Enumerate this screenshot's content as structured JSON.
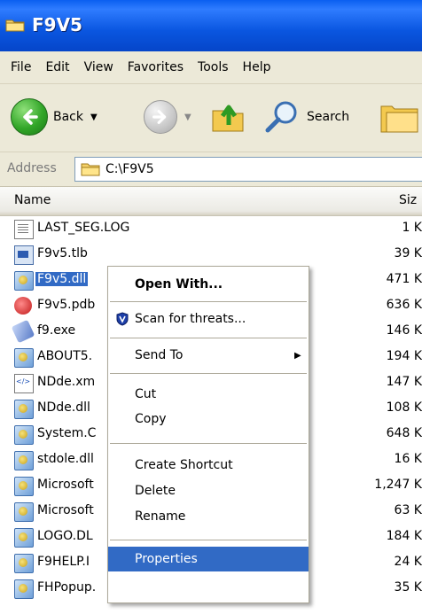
{
  "window": {
    "title": "F9V5"
  },
  "menu": [
    "File",
    "Edit",
    "View",
    "Favorites",
    "Tools",
    "Help"
  ],
  "toolbar": {
    "back_label": "Back",
    "search_label": "Search"
  },
  "address": {
    "label": "Address",
    "value": "C:\\F9V5"
  },
  "columns": {
    "name": "Name",
    "size": "Siz"
  },
  "files": [
    {
      "name": "LAST_SEG.LOG",
      "size": "1 K",
      "icon": "log-file-icon"
    },
    {
      "name": "F9v5.tlb",
      "size": "39 K",
      "icon": "type-library-icon"
    },
    {
      "name": "F9v5.dll",
      "size": "471 K",
      "icon": "dll-file-icon",
      "selected": true
    },
    {
      "name": "F9v5.pdb",
      "size": "636 K",
      "icon": "pdb-file-icon"
    },
    {
      "name": "f9.exe",
      "size": "146 K",
      "icon": "exe-file-icon"
    },
    {
      "name": "ABOUT5.",
      "size": "194 K",
      "icon": "dll-file-icon"
    },
    {
      "name": "NDde.xm",
      "size": "147 K",
      "icon": "xml-file-icon"
    },
    {
      "name": "NDde.dll",
      "size": "108 K",
      "icon": "dll-file-icon"
    },
    {
      "name": "System.C",
      "size": "648 K",
      "icon": "dll-file-icon"
    },
    {
      "name": "stdole.dll",
      "size": "16 K",
      "icon": "dll-file-icon"
    },
    {
      "name": "Microsoft",
      "size": "1,247 K",
      "icon": "dll-file-icon"
    },
    {
      "name": "Microsoft",
      "size": "63 K",
      "icon": "dll-file-icon"
    },
    {
      "name": "LOGO.DL",
      "size": "184 K",
      "icon": "dll-file-icon"
    },
    {
      "name": "F9HELP.I",
      "size": "24 K",
      "icon": "dll-file-icon"
    },
    {
      "name": "FHPopup.",
      "size": "35 K",
      "icon": "dll-file-icon"
    }
  ],
  "context_menu": {
    "open_with": "Open With...",
    "scan": "Scan for threats...",
    "send_to": "Send To",
    "cut": "Cut",
    "copy": "Copy",
    "create_shortcut": "Create Shortcut",
    "delete": "Delete",
    "rename": "Rename",
    "properties": "Properties"
  },
  "colors": {
    "title_bar": "#0a56e0",
    "selection": "#316ac5",
    "chrome": "#ece9d8"
  }
}
